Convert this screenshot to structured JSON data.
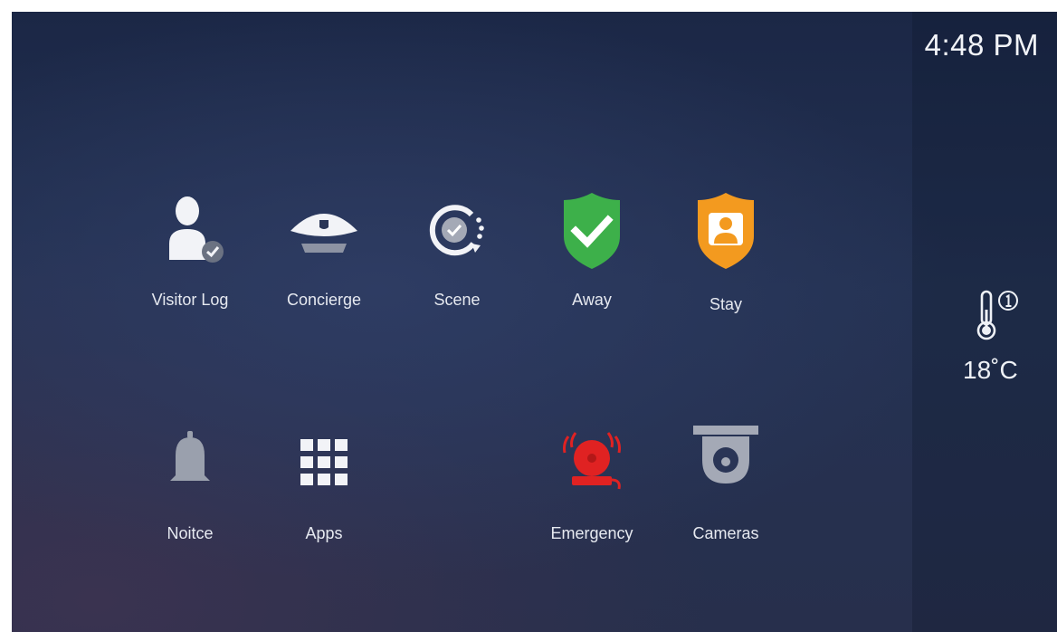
{
  "status": {
    "time": "4:48 PM"
  },
  "weather": {
    "temperature": "18˚C",
    "icon": "thermometer-icon",
    "badge_icon": "info-circle-icon"
  },
  "tiles": [
    {
      "label": "Visitor Log",
      "icon": "visitor-log-icon"
    },
    {
      "label": "Concierge",
      "icon": "concierge-cap-icon"
    },
    {
      "label": "Scene",
      "icon": "scene-icon"
    },
    {
      "label": "Away",
      "icon": "shield-check-icon",
      "color": "#3db04a"
    },
    {
      "label": "Stay",
      "icon": "shield-person-icon",
      "color": "#f39a1f"
    },
    {
      "label": "Noitce",
      "icon": "bell-icon"
    },
    {
      "label": "Apps",
      "icon": "apps-grid-icon"
    },
    {
      "label": "Emergency",
      "icon": "alarm-bell-icon",
      "color": "#e02222"
    },
    {
      "label": "Cameras",
      "icon": "camera-icon"
    }
  ]
}
